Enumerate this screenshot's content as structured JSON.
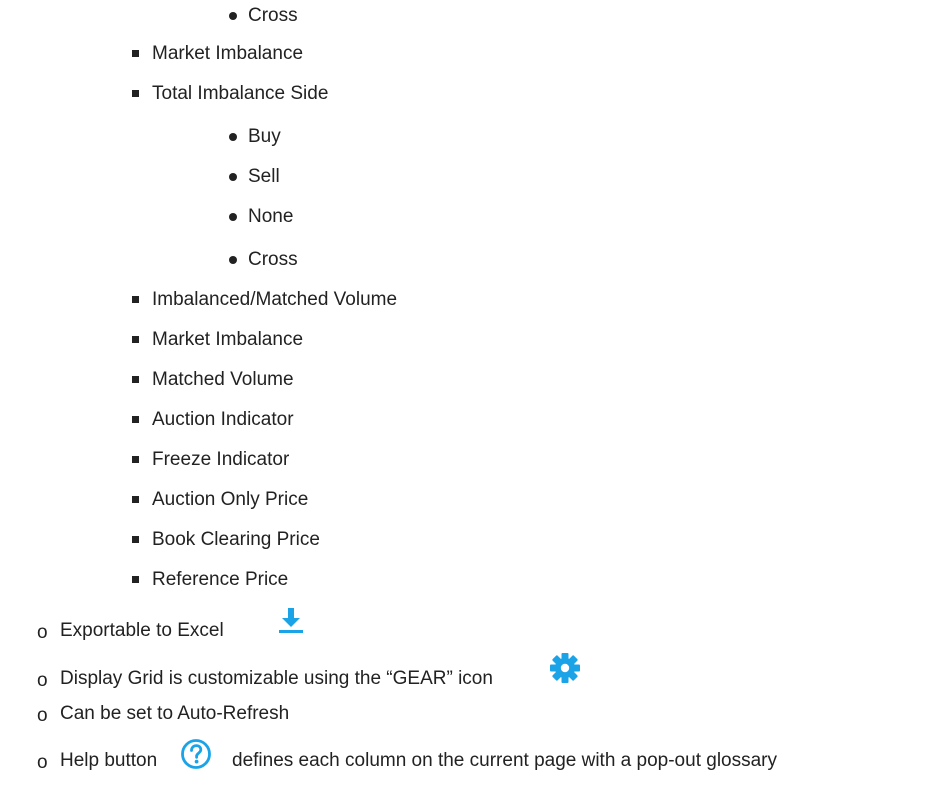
{
  "document": {
    "level3_top": [
      "Cross"
    ],
    "level2_a": [
      "Market Imbalance",
      "Total Imbalance Side"
    ],
    "level3_side": [
      "Buy",
      "Sell",
      "None",
      "Cross"
    ],
    "level2_b": [
      "Imbalanced/Matched Volume",
      "Market Imbalance",
      "Matched Volume",
      "Auction Indicator",
      "Freeze Indicator",
      "Auction Only Price",
      "Book Clearing Price",
      "Reference Price"
    ],
    "level1": {
      "marker": "o",
      "items": [
        "Exportable to Excel",
        "Display Grid is customizable using the “GEAR” icon",
        "Can be set to Auto-Refresh",
        "Help button"
      ],
      "help_suffix": "defines each column on the current page with a pop-out glossary"
    }
  },
  "icons": {
    "download": "download-icon",
    "gear": "gear-icon",
    "help": "help-icon"
  },
  "colors": {
    "text": "#222222",
    "icon_blue": "#1ba3e8"
  }
}
